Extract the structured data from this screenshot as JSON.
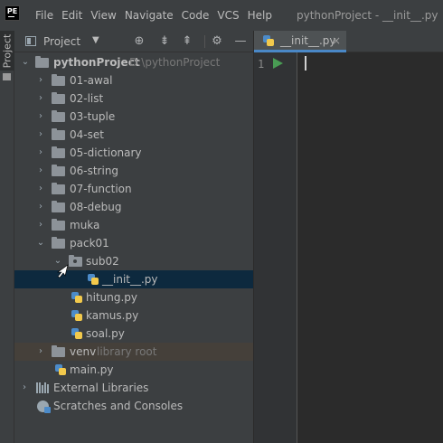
{
  "app": {
    "logo": "PE",
    "window_title": "pythonProject - __init__.py"
  },
  "menu": [
    "File",
    "Edit",
    "View",
    "Navigate",
    "Code",
    "VCS",
    "Help"
  ],
  "toolstrip": {
    "project_tab": "Project"
  },
  "project_panel": {
    "view_label": "Project",
    "dropdown_icon": "caret-down",
    "header_icons": [
      "locate-icon",
      "expand-all-icon",
      "collapse-all-icon",
      "gear-icon",
      "minimize-icon"
    ]
  },
  "tree": [
    {
      "label": "pythonProject",
      "hint": "D:\\pythonProject",
      "type": "folder",
      "state": "expanded"
    },
    {
      "label": "01-awal",
      "type": "folder",
      "state": "collapsed"
    },
    {
      "label": "02-list",
      "type": "folder",
      "state": "collapsed"
    },
    {
      "label": "03-tuple",
      "type": "folder",
      "state": "collapsed"
    },
    {
      "label": "04-set",
      "type": "folder",
      "state": "collapsed"
    },
    {
      "label": "05-dictionary",
      "type": "folder",
      "state": "collapsed"
    },
    {
      "label": "06-string",
      "type": "folder",
      "state": "collapsed"
    },
    {
      "label": "07-function",
      "type": "folder",
      "state": "collapsed"
    },
    {
      "label": "08-debug",
      "type": "folder",
      "state": "collapsed"
    },
    {
      "label": "muka",
      "type": "folder",
      "state": "collapsed"
    },
    {
      "label": "pack01",
      "type": "folder",
      "state": "expanded"
    },
    {
      "label": "sub02",
      "type": "package",
      "state": "expanded"
    },
    {
      "label": "__init__.py",
      "type": "python-file",
      "selected": true
    },
    {
      "label": "hitung.py",
      "type": "python-file"
    },
    {
      "label": "kamus.py",
      "type": "python-file"
    },
    {
      "label": "soal.py",
      "type": "python-file"
    },
    {
      "label": "venv",
      "hint": "library root",
      "type": "folder",
      "state": "collapsed",
      "excluded": true
    },
    {
      "label": "main.py",
      "type": "python-file"
    },
    {
      "label": "External Libraries",
      "type": "libraries",
      "state": "collapsed"
    },
    {
      "label": "Scratches and Consoles",
      "type": "scratches"
    }
  ],
  "editor": {
    "tab": {
      "label": "__init__.py",
      "close": "×"
    },
    "gutter": {
      "line_number": "1"
    }
  },
  "colors": {
    "selection": "#0d293e",
    "excluded_row": "#45403a",
    "tab_underline": "#4a88c7",
    "run_icon": "#499c54",
    "python_blue": "#4c8bc9",
    "python_yellow": "#f2c94c"
  }
}
